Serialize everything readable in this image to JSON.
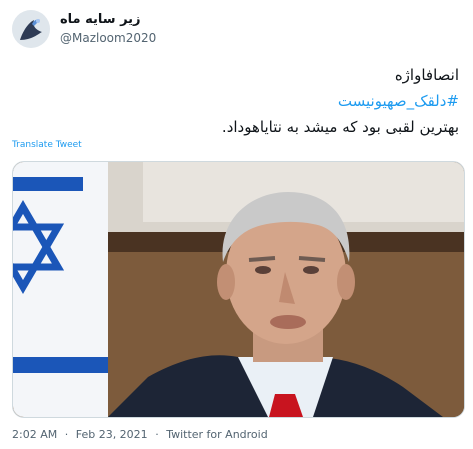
{
  "author": {
    "display_name": "زیر سایه ماه",
    "handle": "@Mazloom2020"
  },
  "tweet": {
    "line1": "انصافاواژه",
    "hashtag": "#دلقک_صهیونیست",
    "line3": "بهترین لقبی بود که میشد به نتایاهوداد."
  },
  "translate_label": "Translate Tweet",
  "meta": {
    "time": "2:02 AM",
    "date": "Feb 23, 2021",
    "separator": "·",
    "source": "Twitter for Android"
  },
  "colors": {
    "link": "#1d9bf0",
    "secondary_text": "#536471",
    "text": "#0f1419"
  }
}
